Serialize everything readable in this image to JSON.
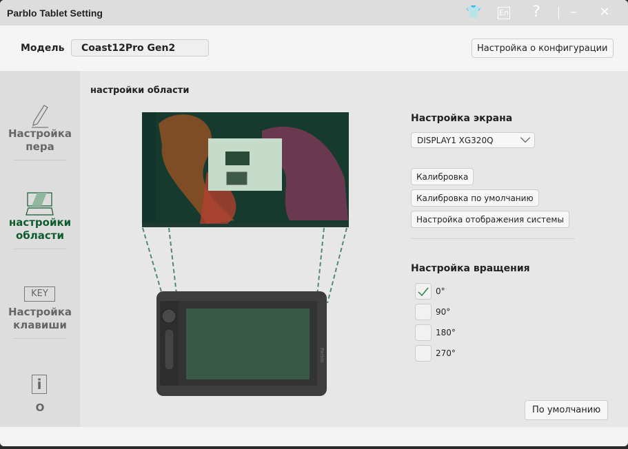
{
  "window": {
    "title": "Parblo Tablet Setting"
  },
  "titlebar_icons": [
    "skin-icon",
    "language-icon",
    "help-icon",
    "minimize-icon",
    "close-icon"
  ],
  "titlebar_glyphs": {
    "skin": "👕",
    "lang": "En",
    "help": "?",
    "min": "–",
    "close": "✕"
  },
  "header": {
    "model_label": "Модель",
    "model_value": "Coast12Pro Gen2",
    "config_button": "Настройка о конфигурации"
  },
  "sidebar": {
    "items": [
      {
        "label1": "Настройка",
        "label2": "пера",
        "icon": "pen-icon"
      },
      {
        "label1": "настройки",
        "label2": "области",
        "icon": "area-icon",
        "active": true
      },
      {
        "label1": "Настройка",
        "label2": "клавиши",
        "icon": "key-icon",
        "icon_text": "KEY"
      },
      {
        "label1": "О",
        "icon": "info-icon",
        "icon_text": "i"
      }
    ]
  },
  "main": {
    "section_title": "настройки области",
    "screen": {
      "title": "Настройка экрана",
      "display": "DISPLAY1 XG320Q",
      "buttons": [
        "Калибровка",
        "Калибровка по умолчанию",
        "Настройка отображения системы"
      ]
    },
    "rotation": {
      "title": "Настройка вращения",
      "options": [
        {
          "label": "0°",
          "checked": true
        },
        {
          "label": "90°",
          "checked": false
        },
        {
          "label": "180°",
          "checked": false
        },
        {
          "label": "270°",
          "checked": false
        }
      ]
    },
    "tablet_brand": "Parblo",
    "default_button": "По умолчанию"
  },
  "colors": {
    "accent": "#0f5a2e",
    "dash": "#4f8a6a"
  }
}
